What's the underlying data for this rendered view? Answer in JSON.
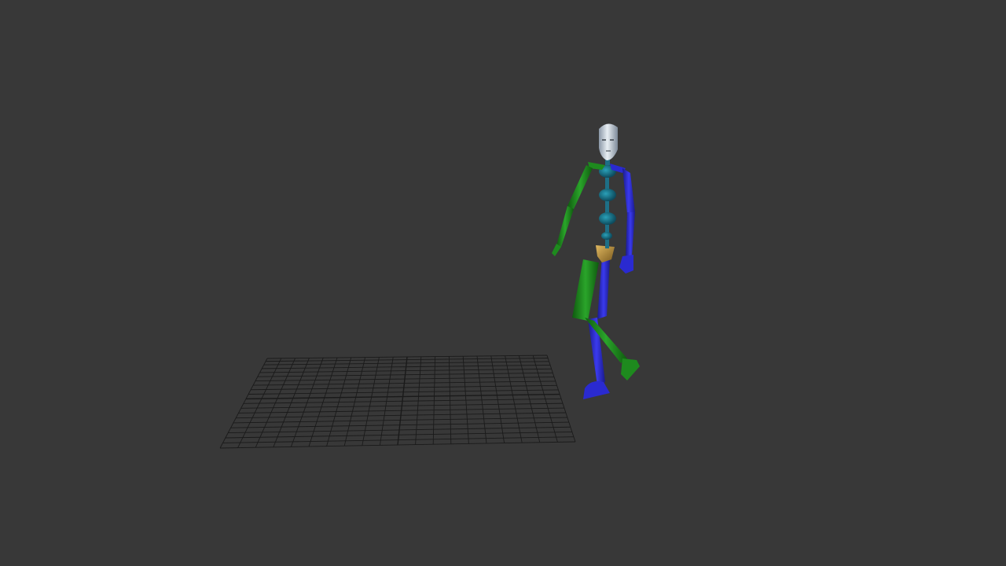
{
  "viewport": {
    "background_color": "#383838"
  },
  "scene": {
    "ground_grid": {
      "line_color": "#1a1a1a",
      "divisions": 20
    },
    "biped": {
      "head_color": "#c9d3dc",
      "spine_color": "#1e6f86",
      "pelvis_color": "#b8913a",
      "left_side_color": "#1e8a1e",
      "right_side_color": "#2a2ad0"
    }
  }
}
